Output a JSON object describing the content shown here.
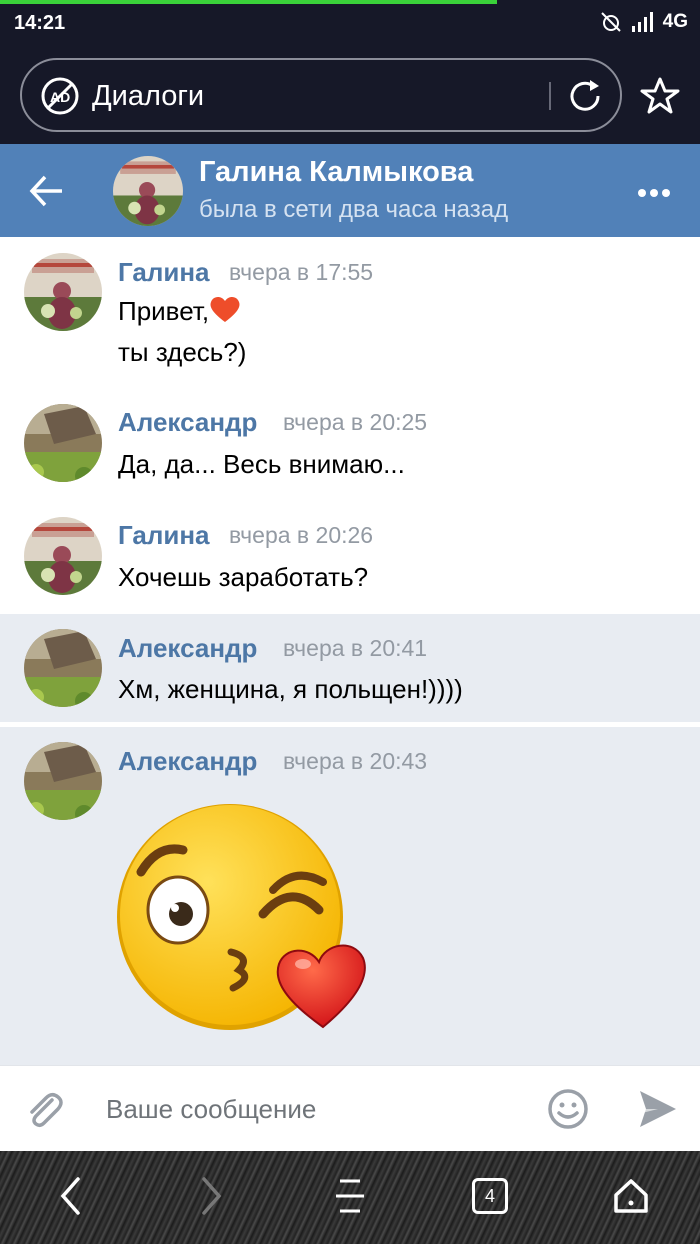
{
  "status_bar": {
    "time": "14:21",
    "network": "4G"
  },
  "browser": {
    "url_title": "Диалоги",
    "tabs_count": "4"
  },
  "chat": {
    "name": "Галина Калмыкова",
    "status": "была в сети два часа назад"
  },
  "messages": [
    {
      "author": "Галина",
      "time": "вчера в 17:55",
      "lines": [
        "Привет,",
        "ты здесь?)"
      ]
    },
    {
      "author": "Александр",
      "time": "вчера в 20:25",
      "lines": [
        "Да, да... Весь внимаю..."
      ]
    },
    {
      "author": "Галина",
      "time": "вчера в 20:26",
      "lines": [
        "Хочешь заработать?"
      ]
    },
    {
      "author": "Александр",
      "time": "вчера в 20:41",
      "lines": [
        "Хм, женщина, я польщен!))))"
      ]
    },
    {
      "author": "Александр",
      "time": "вчера в 20:43",
      "sticker": "kiss-wink-heart-sticker"
    }
  ],
  "composer": {
    "placeholder": "Ваше сообщение"
  },
  "colors": {
    "header": "#5181b8",
    "author": "#4d77a6",
    "selected_bg": "#e8ecf2",
    "system_bar": "#161828"
  }
}
